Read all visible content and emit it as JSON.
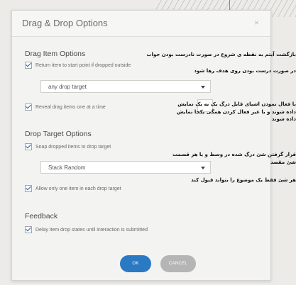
{
  "dialog": {
    "title": "Drag & Drop Options",
    "close_glyph": "×"
  },
  "drag_items": {
    "heading": "Drag Item Options",
    "return_label": "Return item to start point if dropped outside",
    "return_checked": true,
    "target_select_value": "any drop target",
    "reveal_label": "Reveal drag items one at a time",
    "reveal_checked": true
  },
  "drop_targets": {
    "heading": "Drop Target Options",
    "snap_label": "Snap dropped items to drop target",
    "snap_checked": true,
    "snap_select_value": "Stack Random",
    "one_item_label": "Allow only one item in each drop target",
    "one_item_checked": true
  },
  "feedback": {
    "heading": "Feedback",
    "delay_label": "Delay item drop states until interaction is submitted",
    "delay_checked": true
  },
  "buttons": {
    "ok": "OK",
    "cancel": "CANCEL"
  },
  "annotations": {
    "a1_line1": "بازگشت آیتم به نقطه ی شروع در صورت نادرست بودن جواب",
    "a2_line1": "در صورت درست بودن روی هدف رها شود",
    "a3_line1": "با فعال نمودن اشیای قابل درگ یک به یک نمایش",
    "a3_line2": "داده شوند و با غیر فعال کردن همگی یکجا نمایش داده شوند",
    "a4_line1": "قرار گرفتن شئ درگ شده در وسط و یا هر قسمت شئ مقصد",
    "a5_line1": "هر شئ فقط یک موضوع را بتواند قبول کند"
  }
}
